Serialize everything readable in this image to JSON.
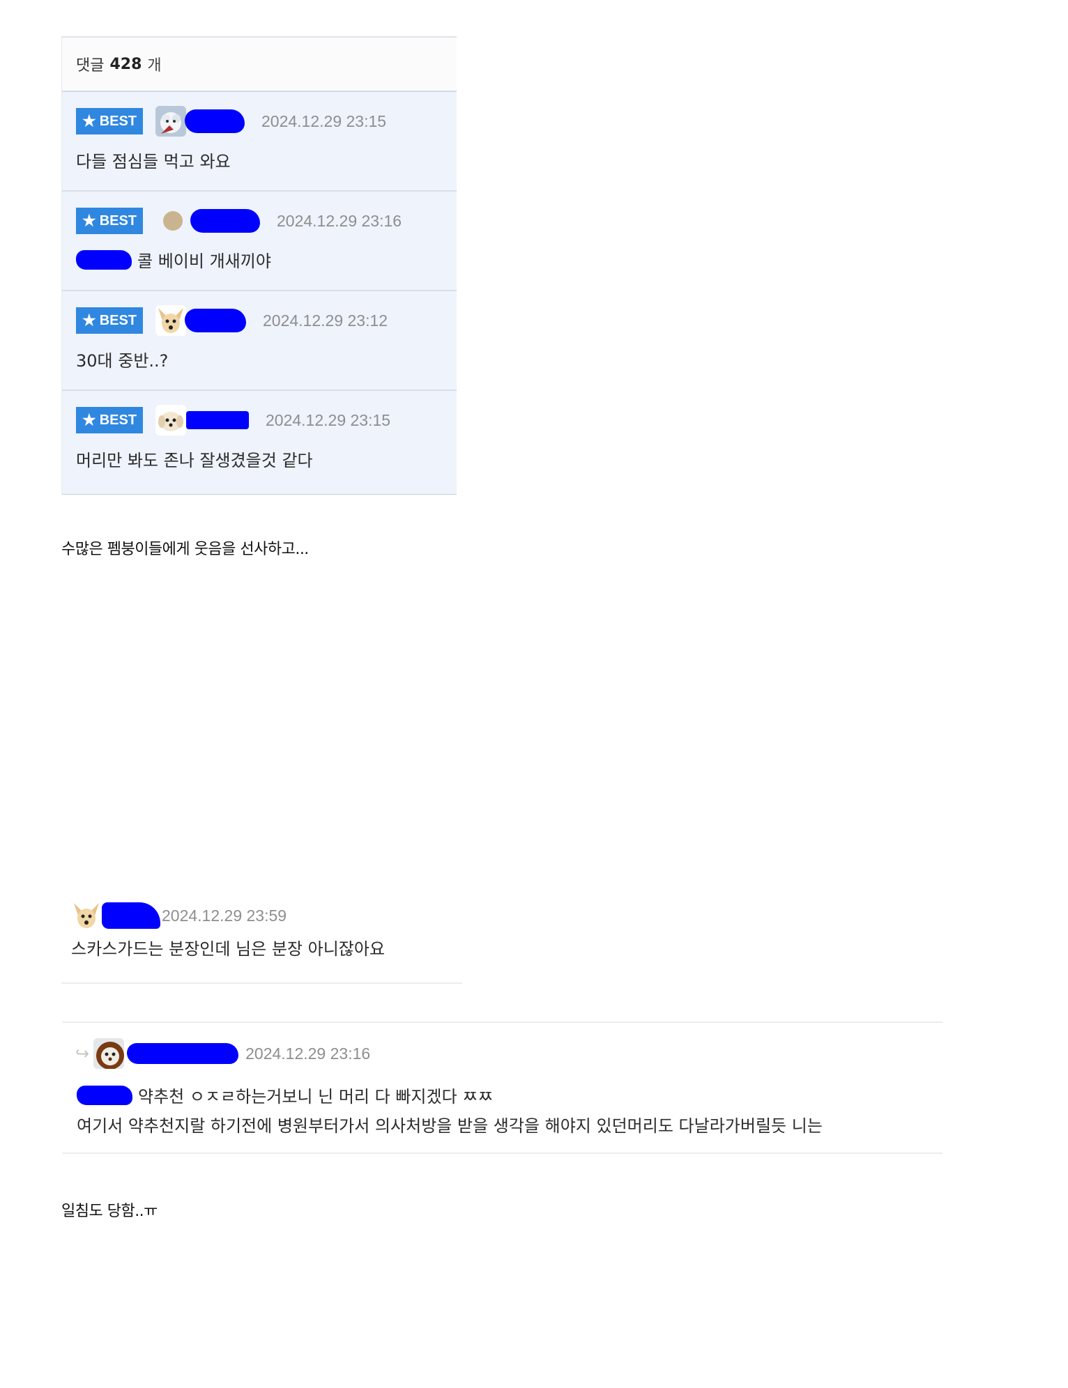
{
  "header": {
    "label": "댓글",
    "count": "428",
    "unit": "개"
  },
  "best_comments": [
    {
      "badge": "BEST",
      "avatar": "white-fluffy-avatar",
      "date": "2024.12.29 23:15",
      "text": "다들 점심들 먹고 와요"
    },
    {
      "badge": "BEST",
      "avatar": "tan-circle-avatar",
      "date": "2024.12.29 23:16",
      "text": "콜 베이비 개새끼야"
    },
    {
      "badge": "BEST",
      "avatar": "chihuahua-avatar",
      "date": "2024.12.29 23:12",
      "text": "30대 중반..?"
    },
    {
      "badge": "BEST",
      "avatar": "puppy-avatar",
      "date": "2024.12.29 23:15",
      "text": "머리만 봐도 존나 잘생겼을것 같다"
    }
  ],
  "caption1": "수많은 펨붕이들에게 웃음을 선사하고...",
  "reply1": {
    "avatar": "chihuahua-avatar",
    "date": "2024.12.29 23:59",
    "text": "스카스가드는 분장인데 님은 분장 아니잖아요"
  },
  "reply2": {
    "avatar": "lion-avatar",
    "date": "2024.12.29 23:16",
    "line1": "약추천 ㅇㅈㄹ하는거보니 닌 머리 다 빠지겠다 ㅉㅉ",
    "line2": "여기서 약추천지랄 하기전에 병원부터가서 의사처방을 받을 생각을 해야지 있던머리도 다날라가버릴듯 니는"
  },
  "caption2": "일침도 당함..ㅠ",
  "colors": {
    "best_badge": "#2f87e0",
    "best_bg": "#eef3fc",
    "redaction": "#0000ff",
    "date": "#8e8e8e"
  }
}
